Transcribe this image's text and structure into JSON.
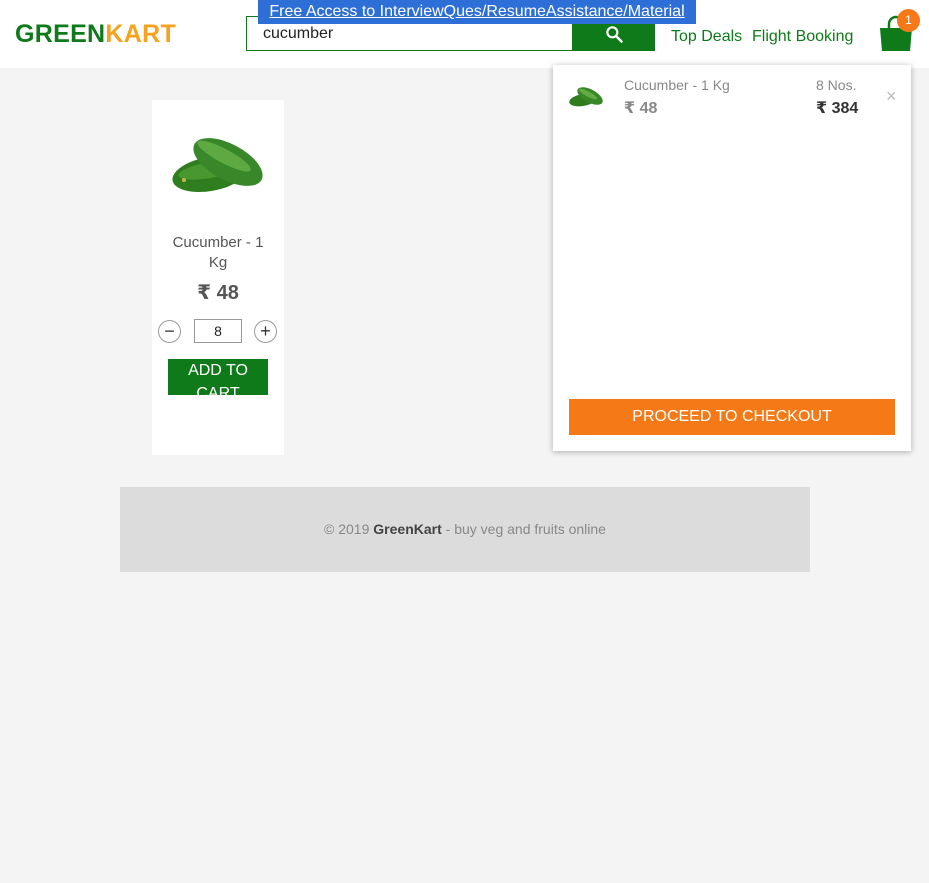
{
  "header": {
    "logo_green": "GREEN",
    "logo_orange": "KART",
    "promo_text": "Free Access to InterviewQues/ResumeAssistance/Material",
    "search_value": "cucumber",
    "nav": {
      "top_deals": "Top Deals",
      "flight_booking": "Flight Booking"
    },
    "cart_count": "1"
  },
  "product": {
    "name": "Cucumber - 1 Kg",
    "price": "₹ 48",
    "quantity": "8",
    "decrement": "−",
    "increment": "+",
    "add_label": "ADD TO CART"
  },
  "cart_preview": {
    "item_name": "Cucumber - 1 Kg",
    "item_price": "₹ 48",
    "item_qty": "8 Nos.",
    "item_total": "₹ 384",
    "remove": "×",
    "checkout_label": "PROCEED TO CHECKOUT"
  },
  "footer": {
    "copyright": "© 2019",
    "brand": "GreenKart",
    "tagline": "- buy veg and fruits online"
  },
  "colors": {
    "green": "#0f7a19",
    "orange": "#f57a17",
    "promo_blue": "#2d6fd6"
  },
  "icons": [
    "search-icon",
    "shopping-bag-icon",
    "cucumber-image",
    "close-icon"
  ]
}
